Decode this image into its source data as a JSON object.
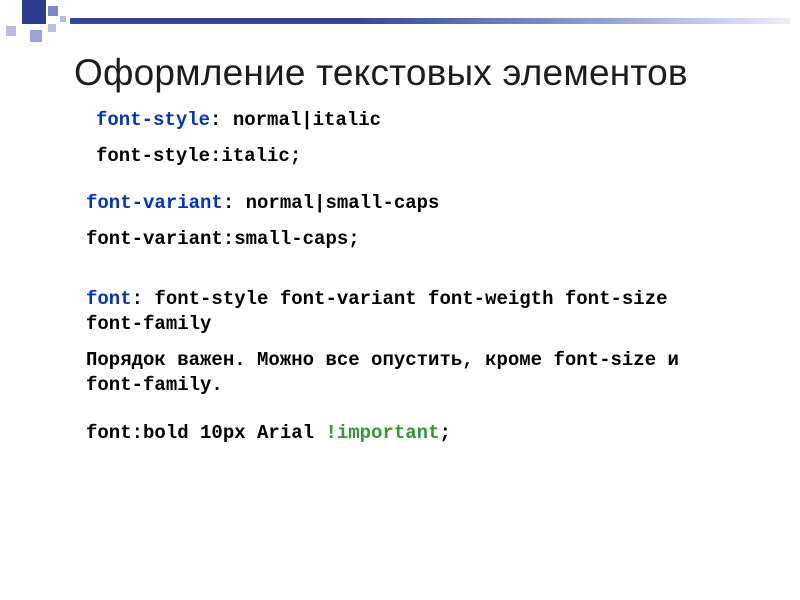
{
  "title": "Оформление текстовых элементов",
  "lines": {
    "0": {
      "prop": "font-style",
      "rest": ": normal|italic"
    },
    "1": {
      "text": "font-style:italic;"
    },
    "2": {
      "prop": "font-variant",
      "rest": ": normal|small-caps"
    },
    "3": {
      "text": "font-variant:small-caps;"
    },
    "4": {
      "prop": "font",
      "rest": ": font-style font-variant font-weigth  font-size font-family"
    },
    "5": {
      "text": "Порядок важен. Можно все опустить, кроме font-size и font-family."
    },
    "6": {
      "pre": "font:bold 10px Arial ",
      "imp": "!important",
      "post": ";"
    }
  }
}
